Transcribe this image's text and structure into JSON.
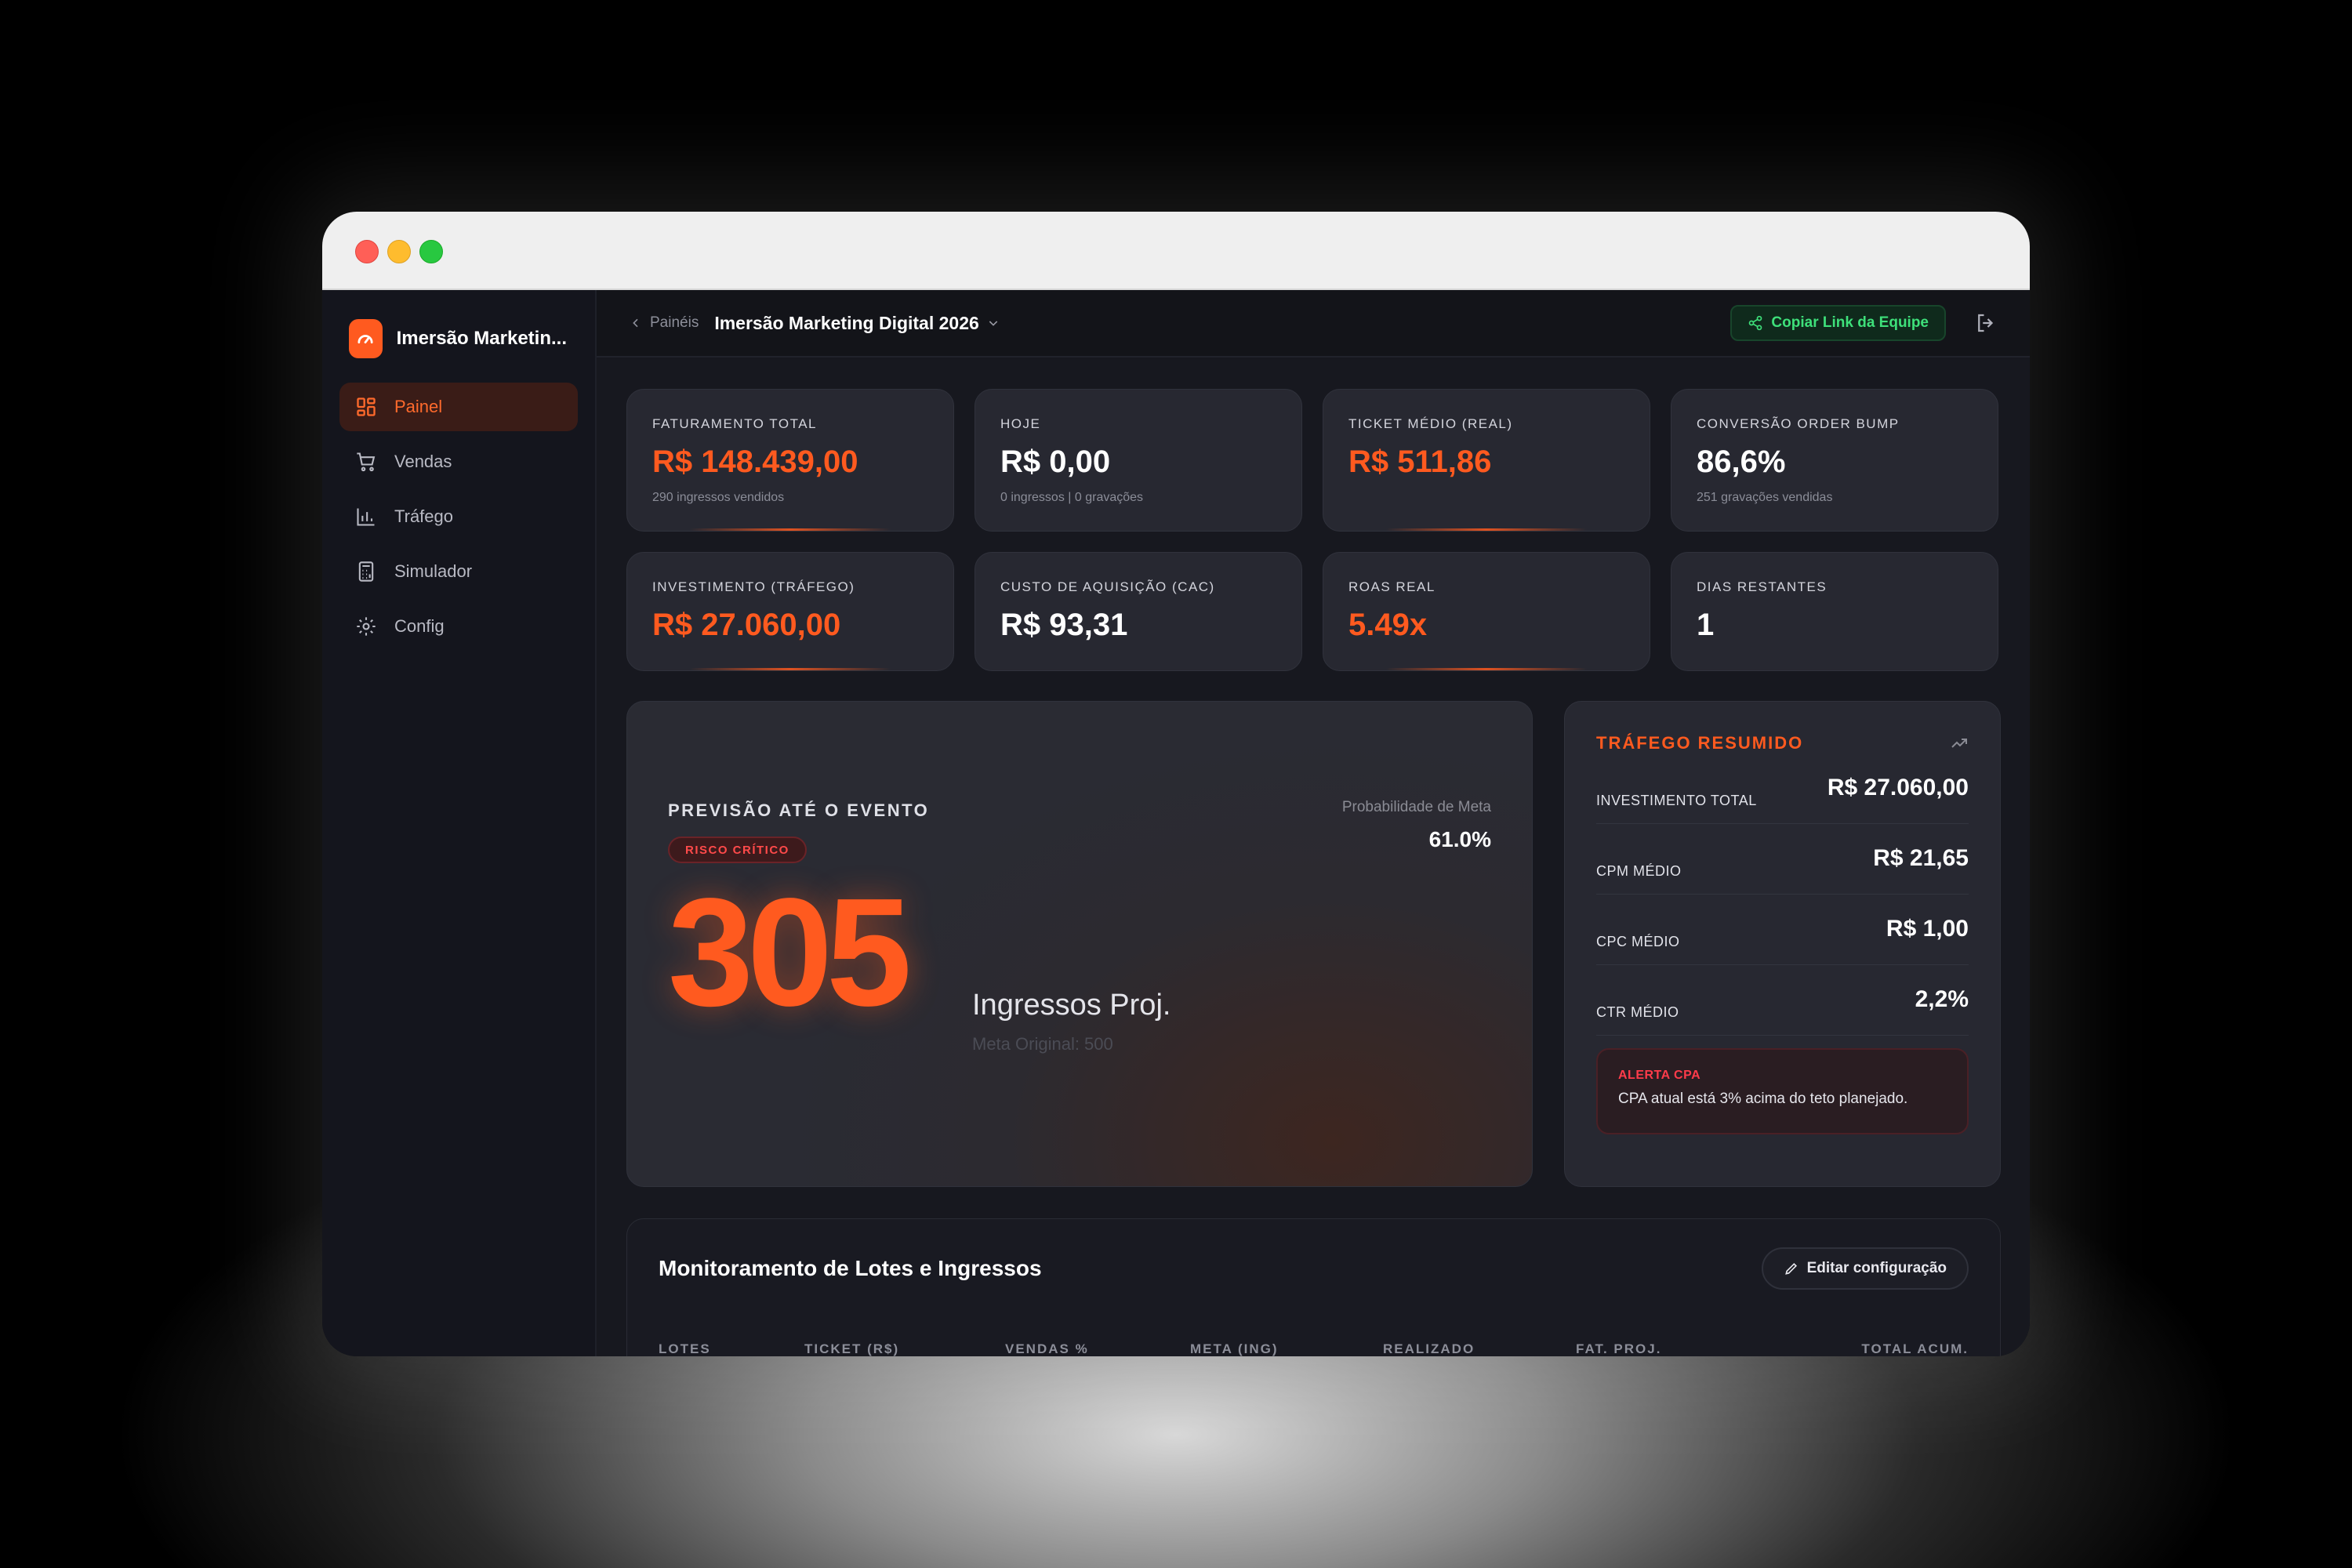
{
  "window": {
    "traffic_lights": [
      "close",
      "minimize",
      "maximize"
    ]
  },
  "brand": {
    "name": "Imersão Marketin...",
    "color": "#ff5a1f"
  },
  "sidebar": {
    "items": [
      {
        "label": "Painel",
        "icon": "grid-icon",
        "active": true
      },
      {
        "label": "Vendas",
        "icon": "cart-icon",
        "active": false
      },
      {
        "label": "Tráfego",
        "icon": "bar-chart-icon",
        "active": false
      },
      {
        "label": "Simulador",
        "icon": "calculator-icon",
        "active": false
      },
      {
        "label": "Config",
        "icon": "gear-icon",
        "active": false
      }
    ]
  },
  "topbar": {
    "back_label": "Painéis",
    "title": "Imersão Marketing Digital 2026",
    "copy_link_label": "Copiar Link da Equipe"
  },
  "kpis": [
    {
      "label": "FATURAMENTO TOTAL",
      "value": "R$ 148.439,00",
      "sub": "290 ingressos vendidos",
      "accent": true
    },
    {
      "label": "HOJE",
      "value": "R$ 0,00",
      "sub": "0 ingressos | 0 gravações",
      "accent": false
    },
    {
      "label": "TICKET MÉDIO (REAL)",
      "value": "R$ 511,86",
      "sub": "",
      "accent": true
    },
    {
      "label": "CONVERSÃO ORDER BUMP",
      "value": "86,6%",
      "sub": "251 gravações vendidas",
      "accent": false
    },
    {
      "label": "INVESTIMENTO (TRÁFEGO)",
      "value": "R$ 27.060,00",
      "accent": true
    },
    {
      "label": "CUSTO DE AQUISIÇÃO (CAC)",
      "value": "R$ 93,31",
      "accent": false
    },
    {
      "label": "ROAS REAL",
      "value": "5.49x",
      "accent": true
    },
    {
      "label": "DIAS RESTANTES",
      "value": "1",
      "accent": false
    }
  ],
  "forecast": {
    "title": "PREVISÃO ATÉ O EVENTO",
    "risk_badge": "RISCO CRÍTICO",
    "value": "305",
    "unit_label": "Ingressos Proj.",
    "original_goal": "Meta Original: 500",
    "probability_label": "Probabilidade de Meta",
    "probability_value": "61.0%"
  },
  "traffic": {
    "title": "TRÁFEGO RESUMIDO",
    "rows": [
      {
        "label": "INVESTIMENTO TOTAL",
        "value": "R$ 27.060,00"
      },
      {
        "label": "CPM MÉDIO",
        "value": "R$ 21,65"
      },
      {
        "label": "CPC MÉDIO",
        "value": "R$ 1,00"
      },
      {
        "label": "CTR MÉDIO",
        "value": "2,2%"
      }
    ],
    "alert_title": "ALERTA CPA",
    "alert_text": "CPA atual está 3% acima do teto planejado."
  },
  "lots": {
    "title": "Monitoramento de Lotes e Ingressos",
    "edit_label": "Editar configuração",
    "columns": [
      "LOTES",
      "TICKET (R$)",
      "VENDAS %",
      "META (ING)",
      "REALIZADO",
      "FAT. PROJ.",
      "TOTAL ACUM."
    ]
  }
}
